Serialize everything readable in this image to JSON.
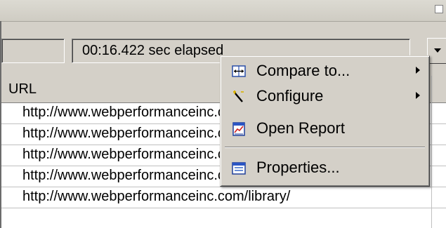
{
  "toolbar": {
    "elapsed_text": "00:16.422 sec elapsed"
  },
  "table": {
    "column_header": "URL",
    "rows": [
      "http://www.webperformanceinc.com/",
      "http://www.webperformanceinc.com/products/",
      "http://www.webperformanceinc.com/services/",
      "http://www.webperformanceinc.com/support/",
      "http://www.webperformanceinc.com/library/"
    ]
  },
  "context_menu": {
    "items": [
      {
        "label": "Compare to...",
        "icon": "compare-icon",
        "has_submenu": true
      },
      {
        "label": "Configure",
        "icon": "wand-icon",
        "has_submenu": true
      },
      {
        "label": "Open Report",
        "icon": "report-icon",
        "has_submenu": false
      },
      {
        "label": "Properties...",
        "icon": "properties-icon",
        "has_submenu": false
      }
    ]
  }
}
